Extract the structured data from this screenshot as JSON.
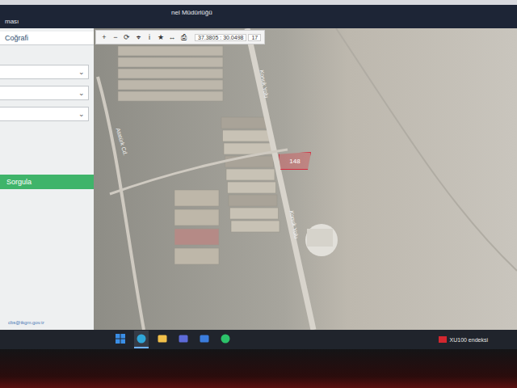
{
  "header": {
    "title": "nel Müdürlüğü",
    "subtitle": "ması"
  },
  "sidebar": {
    "heading": "Coğrafi",
    "dropdowns": [
      {
        "value": "",
        "chevron": "⌄"
      },
      {
        "value": "",
        "chevron": "⌄"
      },
      {
        "value": "",
        "chevron": "⌄"
      }
    ],
    "button": "Sorgula",
    "footer": "cbs@tkgm.gov.tr"
  },
  "toolbar": {
    "tools": [
      "+",
      "−",
      "⟳",
      "⌖",
      "i",
      "★",
      "↔",
      "⎙"
    ],
    "coordinates": "37.3805 : 30.0498",
    "zoom": "17"
  },
  "map": {
    "parcel": {
      "label": "148",
      "selected": true
    },
    "roads": [
      {
        "label": "Konuk Yolu"
      },
      {
        "label": "Konuk Yolu"
      },
      {
        "label": "Atatürk Cd."
      }
    ]
  },
  "taskbar": {
    "apps": [
      {
        "kind": "windows",
        "selected": false
      },
      {
        "kind": "edge",
        "selected": true
      },
      {
        "kind": "files",
        "selected": false
      },
      {
        "kind": "store",
        "selected": false
      },
      {
        "kind": "mail",
        "selected": false
      },
      {
        "kind": "whatsapp",
        "selected": false
      }
    ],
    "news": "XU100 endeksi"
  }
}
